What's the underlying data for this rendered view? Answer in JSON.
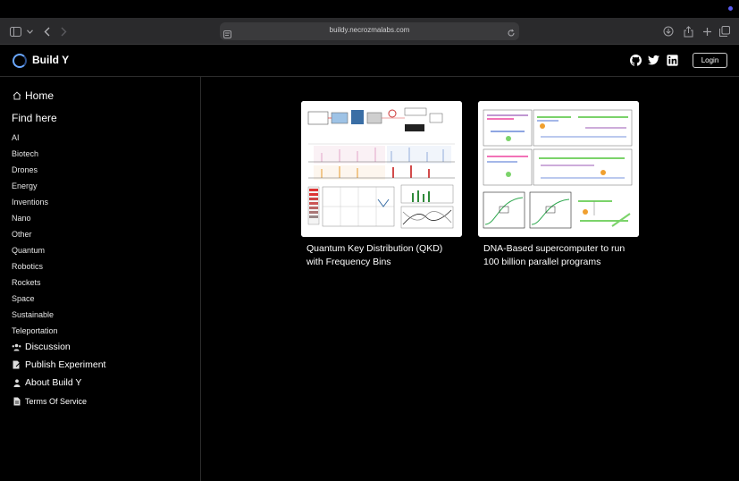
{
  "browser": {
    "url": "buildy.necrozmalabs.com",
    "icons": [
      "sidebar-toggle-icon",
      "chevron-down-icon",
      "back-icon",
      "forward-icon",
      "site-settings-icon",
      "reload-icon",
      "download-icon",
      "share-icon",
      "new-tab-icon",
      "tabs-overview-icon"
    ]
  },
  "header": {
    "brand": "Build Y",
    "login_label": "Login",
    "social_icons": [
      "github-icon",
      "twitter-icon",
      "linkedin-icon"
    ]
  },
  "sidebar": {
    "home_label": "Home",
    "find_here_label": "Find here",
    "categories": [
      "AI",
      "Biotech",
      "Drones",
      "Energy",
      "Inventions",
      "Nano",
      "Other",
      "Quantum",
      "Robotics",
      "Rockets",
      "Space",
      "Sustainable",
      "Teleportation"
    ],
    "links": [
      {
        "label": "Discussion",
        "icon": "users-icon"
      },
      {
        "label": "Publish Experiment",
        "icon": "edit-document-icon"
      },
      {
        "label": "About Build Y",
        "icon": "user-icon"
      },
      {
        "label": "Terms Of Service",
        "icon": "document-icon"
      }
    ]
  },
  "main": {
    "cards": [
      {
        "title": "Quantum Key Distribution (QKD) with Frequency Bins"
      },
      {
        "title": "DNA-Based supercomputer to run 100 billion parallel programs"
      }
    ]
  },
  "colors": {
    "background": "#000000",
    "toolbar": "#2a2a2c",
    "accent_ring": "#6aa7ff"
  }
}
